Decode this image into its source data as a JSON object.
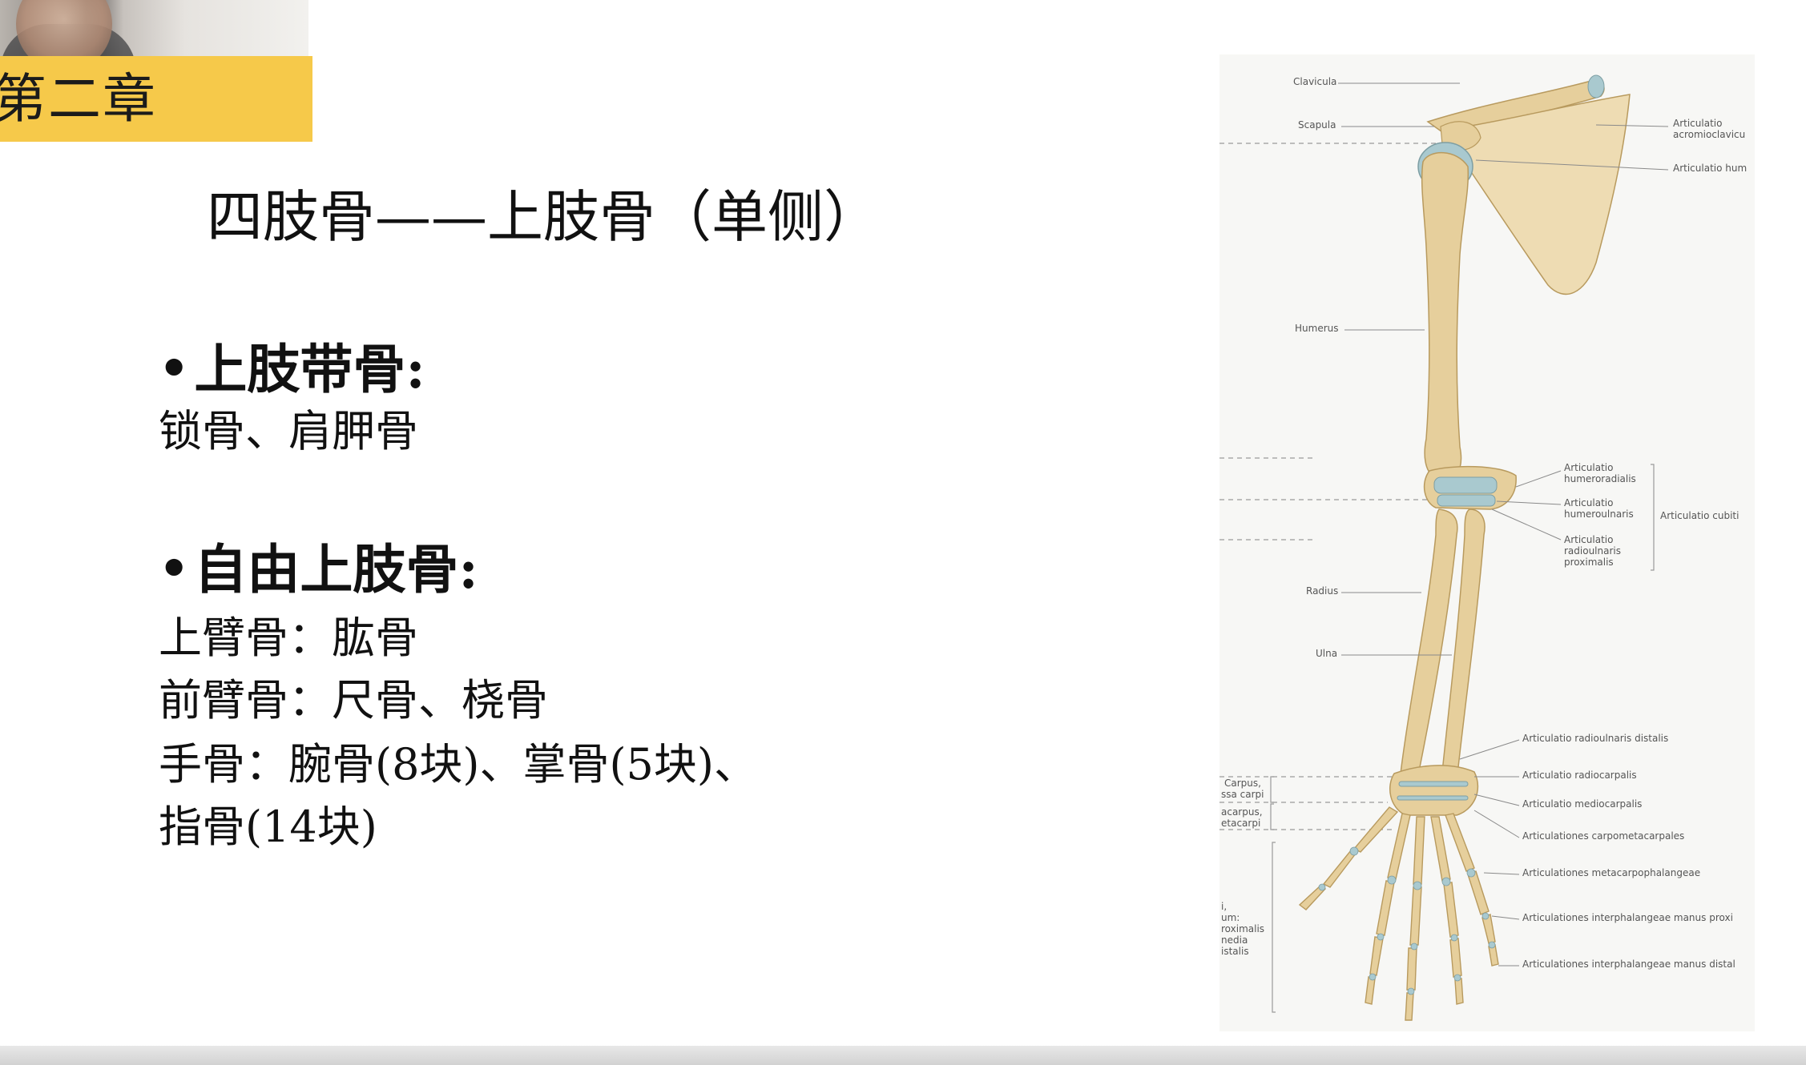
{
  "chapter_banner": "第二章",
  "slide_title": "四肢骨——上肢骨（单侧）",
  "sections": [
    {
      "bullet": "•",
      "heading": "上肢带骨:",
      "lines": [
        "锁骨、肩胛骨"
      ]
    },
    {
      "bullet": "•",
      "heading": "自由上肢骨:",
      "lines": [
        "上臂骨：肱骨",
        "前臂骨：尺骨、桡骨",
        "手骨：腕骨(8块)、掌骨(5块)、",
        "指骨(14块)"
      ]
    }
  ],
  "figure": {
    "labels_left": [
      "Clavicula",
      "Scapula",
      "Humerus",
      "Radius",
      "Ulna",
      "Carpus,",
      "ssa carpi",
      "acarpus,",
      "etacarpi",
      "i,",
      "um:",
      "roximalis",
      "nedia",
      "istalis"
    ],
    "labels_right": [
      "Articulatio",
      "acromioclavicu",
      "Articulatio hum",
      "Articulatio",
      "humeroradialis",
      "Articulatio",
      "humeroulnaris",
      "Articulatio",
      "radioulnaris",
      "proximalis",
      "Articulatio cubiti",
      "Articulatio radioulnaris distalis",
      "Articulatio radiocarpalis",
      "Articulatio mediocarpalis",
      "Articulationes carpometacarpales",
      "Articulationes metacarpophalangeae",
      "Articulationes interphalangeae manus proxi",
      "Articulationes interphalangeae manus distal"
    ],
    "bone_color": "#e6cf9c",
    "cartilage_color": "#a9c9cf"
  }
}
